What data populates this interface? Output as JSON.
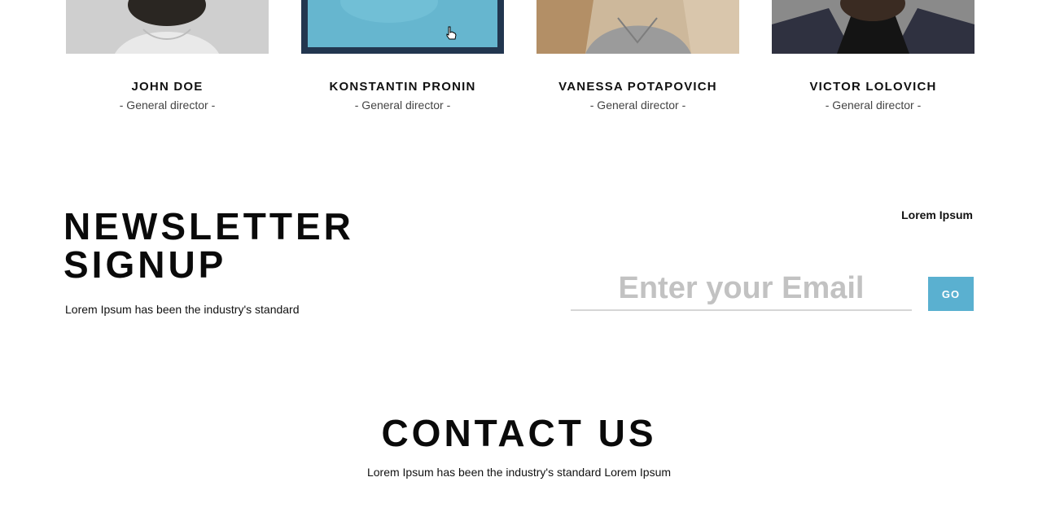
{
  "team": {
    "members": [
      {
        "name": "JOHN DOE",
        "role": "- General director -"
      },
      {
        "name": "KONSTANTIN PRONIN",
        "role": "- General director -"
      },
      {
        "name": "VANESSA POTAPOVICH",
        "role": "- General director -"
      },
      {
        "name": "VICTOR LOLOVICH",
        "role": "- General director -"
      }
    ]
  },
  "newsletter": {
    "title_line1": "NEWSLETTER",
    "title_line2": "SIGNUP",
    "subtitle": "Lorem Ipsum has been the industry's standard",
    "side_text": "Lorem Ipsum",
    "email_placeholder": "Enter your Email",
    "go_label": "GO"
  },
  "contact": {
    "title": "CONTACT US",
    "subtitle": "Lorem Ipsum has been the industry's standard Lorem Ipsum"
  },
  "colors": {
    "accent": "#5ab0d0",
    "overlay": "#66b6cf"
  }
}
